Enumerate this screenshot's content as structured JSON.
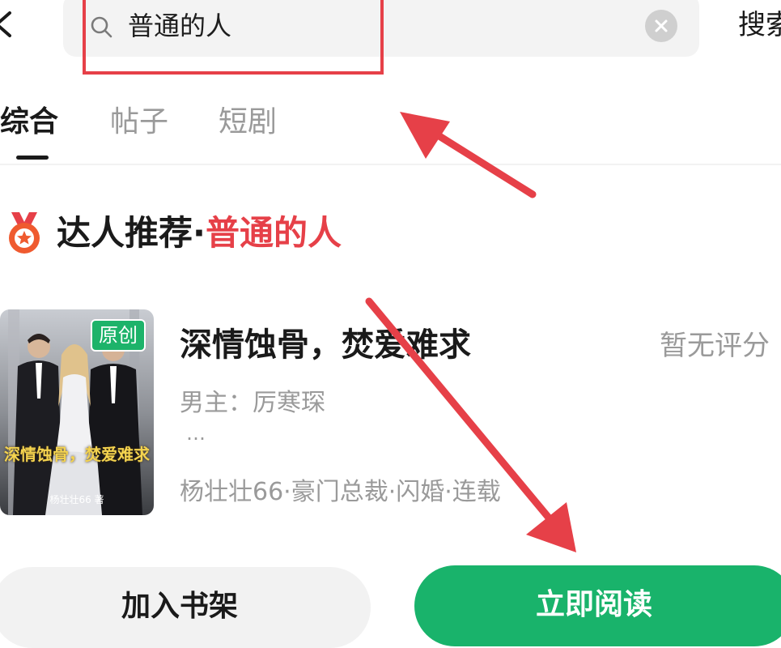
{
  "header": {
    "back_icon": "chevron-left-icon",
    "search": {
      "icon": "search-icon",
      "query": "普通的人",
      "clear_icon": "clear-icon"
    },
    "search_button_label": "搜索"
  },
  "tabs": [
    {
      "label": "综合",
      "active": true
    },
    {
      "label": "帖子",
      "active": false
    },
    {
      "label": "短剧",
      "active": false
    }
  ],
  "section": {
    "icon": "medal-icon",
    "title_prefix": "达人推荐·",
    "keyword": "普通的人"
  },
  "book": {
    "badge": "原创",
    "cover_title": "深情蚀骨，焚爱难求",
    "cover_author": "杨壮壮66 著",
    "title": "深情蚀骨，焚爱难求",
    "rating": "暂无评分",
    "description": "男主：厉寒琛",
    "ellipsis": "…",
    "meta": "杨壮壮66·豪门总裁·闪婚·连载"
  },
  "actions": {
    "shelf_label": "加入书架",
    "read_label": "立即阅读"
  },
  "colors": {
    "accent_red": "#e64048",
    "brand_green": "#19b36b",
    "text_gray": "#9a9a9a"
  }
}
